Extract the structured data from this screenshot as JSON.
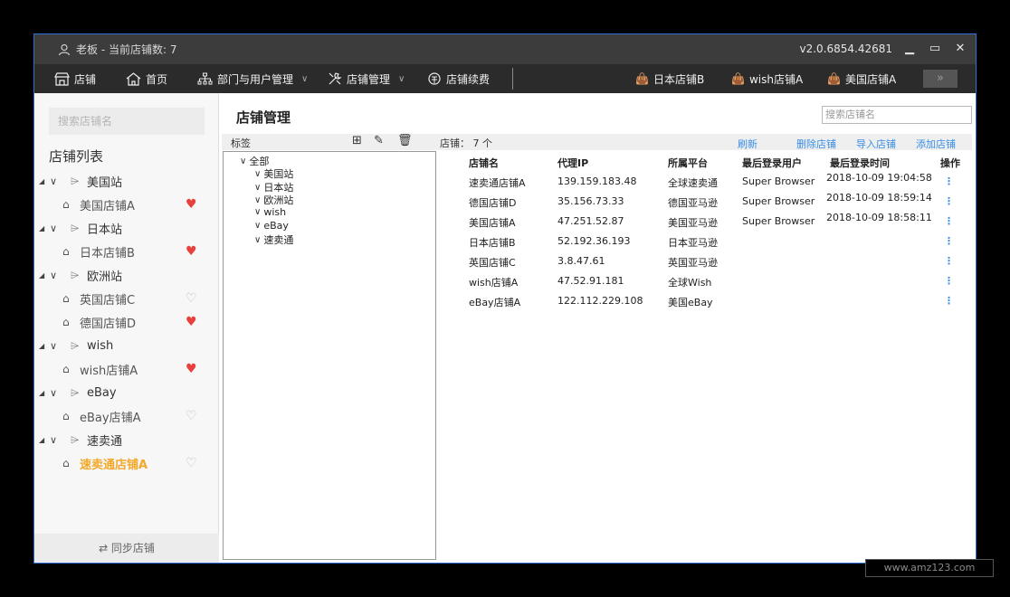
{
  "titlebar": {
    "user_text": "老板 - 当前店铺数: 7",
    "version": "v2.0.6854.42681",
    "minimize": "▁",
    "maximize": "▭",
    "close": "✕"
  },
  "nav": {
    "items": [
      {
        "label": "店铺",
        "icon": "store-icon"
      },
      {
        "label": "首页",
        "icon": "home-icon"
      },
      {
        "label": "部门与用户管理",
        "icon": "org-icon",
        "dropdown": true
      },
      {
        "label": "店铺管理",
        "icon": "tools-icon",
        "dropdown": true
      },
      {
        "label": "店铺续费",
        "icon": "renew-icon"
      }
    ],
    "shop_tabs": [
      "日本店铺B",
      "wish店铺A",
      "美国店铺A"
    ],
    "more": "»"
  },
  "sidebar": {
    "search_placeholder": "搜索店铺名",
    "title": "店铺列表",
    "groups": [
      {
        "label": "美国站",
        "stores": [
          {
            "label": "美国店铺A",
            "favorite": true
          }
        ]
      },
      {
        "label": "日本站",
        "stores": [
          {
            "label": "日本店铺B",
            "favorite": true
          }
        ]
      },
      {
        "label": "欧洲站",
        "stores": [
          {
            "label": "英国店铺C",
            "favorite": false
          },
          {
            "label": "德国店铺D",
            "favorite": true
          }
        ]
      },
      {
        "label": "wish",
        "stores": [
          {
            "label": "wish店铺A",
            "favorite": true
          }
        ]
      },
      {
        "label": "eBay",
        "stores": [
          {
            "label": "eBay店铺A",
            "favorite": false
          }
        ]
      },
      {
        "label": "速卖通",
        "stores": [
          {
            "label": "速卖通店铺A",
            "favorite": false,
            "active": true
          }
        ]
      }
    ],
    "sync_label": "⇄  同步店铺"
  },
  "main": {
    "title": "店铺管理",
    "search_placeholder": "搜索店铺名",
    "toolbar": {
      "tags_label": "标签",
      "store_count_label": "店铺：  7  个",
      "refresh": "刷新",
      "delete": "删除店铺",
      "import": "导入店铺",
      "add": "添加店铺"
    },
    "tag_tree": {
      "root": "全部",
      "children": [
        "美国站",
        "日本站",
        "欧洲站",
        "wish",
        "eBay",
        "速卖通"
      ]
    },
    "table": {
      "headers": [
        "店铺名",
        "代理IP",
        "所属平台",
        "最后登录用户",
        "最后登录时间",
        "操作"
      ],
      "rows": [
        [
          "速卖通店铺A",
          "139.159.183.48",
          "全球速卖通",
          "Super Browser",
          "2018-10-09 19:04:58"
        ],
        [
          "德国店铺D",
          "35.156.73.33",
          "德国亚马逊",
          "Super Browser",
          "2018-10-09 18:59:14"
        ],
        [
          "美国店铺A",
          "47.251.52.87",
          "美国亚马逊",
          "Super Browser",
          "2018-10-09 18:58:11"
        ],
        [
          "日本店铺B",
          "52.192.36.193",
          "日本亚马逊",
          "",
          ""
        ],
        [
          "英国店铺C",
          "3.8.47.61",
          "英国亚马逊",
          "",
          ""
        ],
        [
          "wish店铺A",
          "47.52.91.181",
          "全球Wish",
          "",
          ""
        ],
        [
          "eBay店铺A",
          "122.112.229.108",
          "美国eBay",
          "",
          ""
        ]
      ],
      "action_glyph": "⋮"
    }
  },
  "watermark": "www.amz123.com",
  "colors": {
    "accent": "#3a8ee6",
    "favorite": "#e8403c",
    "active_store": "#f2a92b"
  }
}
